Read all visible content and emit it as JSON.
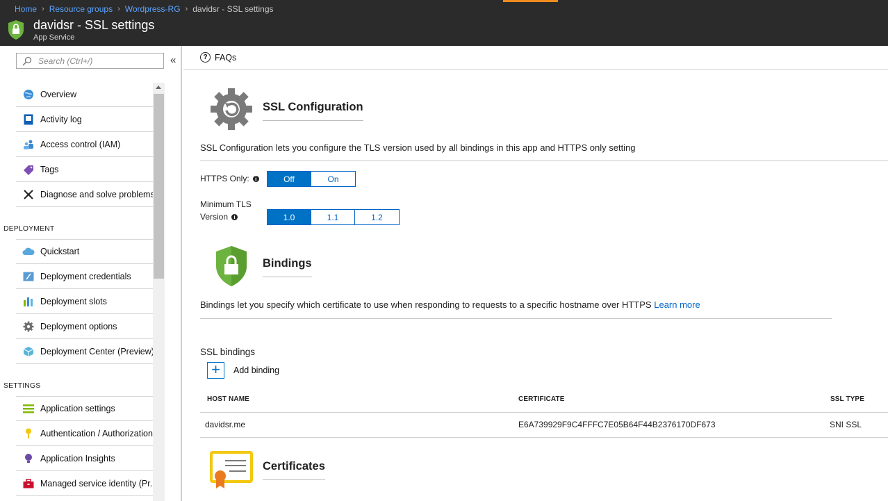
{
  "header": {
    "breadcrumb": [
      "Home",
      "Resource groups",
      "Wordpress-RG",
      "davidsr - SSL settings"
    ],
    "title": "davidsr - SSL settings",
    "subtitle": "App Service"
  },
  "sidebar": {
    "search_placeholder": "Search (Ctrl+/)",
    "collapse_glyph": "«",
    "items_top": [
      {
        "label": "Overview",
        "icon": "globe-icon"
      },
      {
        "label": "Activity log",
        "icon": "activity-log-icon"
      },
      {
        "label": "Access control (IAM)",
        "icon": "people-icon"
      },
      {
        "label": "Tags",
        "icon": "tag-icon"
      },
      {
        "label": "Diagnose and solve problems",
        "icon": "wrench-icon"
      }
    ],
    "section_deployment": "DEPLOYMENT",
    "items_deployment": [
      {
        "label": "Quickstart",
        "icon": "cloud-icon"
      },
      {
        "label": "Deployment credentials",
        "icon": "credentials-icon"
      },
      {
        "label": "Deployment slots",
        "icon": "slots-icon"
      },
      {
        "label": "Deployment options",
        "icon": "gear-icon"
      },
      {
        "label": "Deployment Center (Preview)",
        "icon": "cube-icon"
      }
    ],
    "section_settings": "SETTINGS",
    "items_settings": [
      {
        "label": "Application settings",
        "icon": "settings-bars-icon"
      },
      {
        "label": "Authentication / Authorization",
        "icon": "key-icon"
      },
      {
        "label": "Application Insights",
        "icon": "lightbulb-icon"
      },
      {
        "label": "Managed service identity (Pr...",
        "icon": "toolbox-icon"
      }
    ]
  },
  "commandbar": {
    "faqs": "FAQs"
  },
  "ssl_config": {
    "title": "SSL Configuration",
    "description": "SSL Configuration lets you configure the TLS version used by all bindings in this app and HTTPS only setting",
    "https_only_label": "HTTPS Only:",
    "https_options": [
      "Off",
      "On"
    ],
    "https_selected": "Off",
    "tls_label_line1": "Minimum TLS",
    "tls_label_line2": "Version",
    "tls_options": [
      "1.0",
      "1.1",
      "1.2"
    ],
    "tls_selected": "1.0"
  },
  "bindings": {
    "title": "Bindings",
    "description": "Bindings let you specify which certificate to use when responding to requests to a specific hostname over HTTPS",
    "learn_more": "Learn more",
    "ssl_bindings_heading": "SSL bindings",
    "add_binding": "Add binding",
    "columns": [
      "HOST NAME",
      "CERTIFICATE",
      "SSL TYPE"
    ],
    "rows": [
      {
        "host": "davidsr.me",
        "certificate": "E6A739929F9C4FFFC7E05B64F44B2376170DF673",
        "ssl_type": "SNI SSL"
      }
    ]
  },
  "certificates": {
    "title": "Certificates"
  },
  "colors": {
    "accent": "#0072c6",
    "header_bg": "#2b2b2b",
    "shield_green": "#6db33f",
    "link": "#0066cc"
  }
}
